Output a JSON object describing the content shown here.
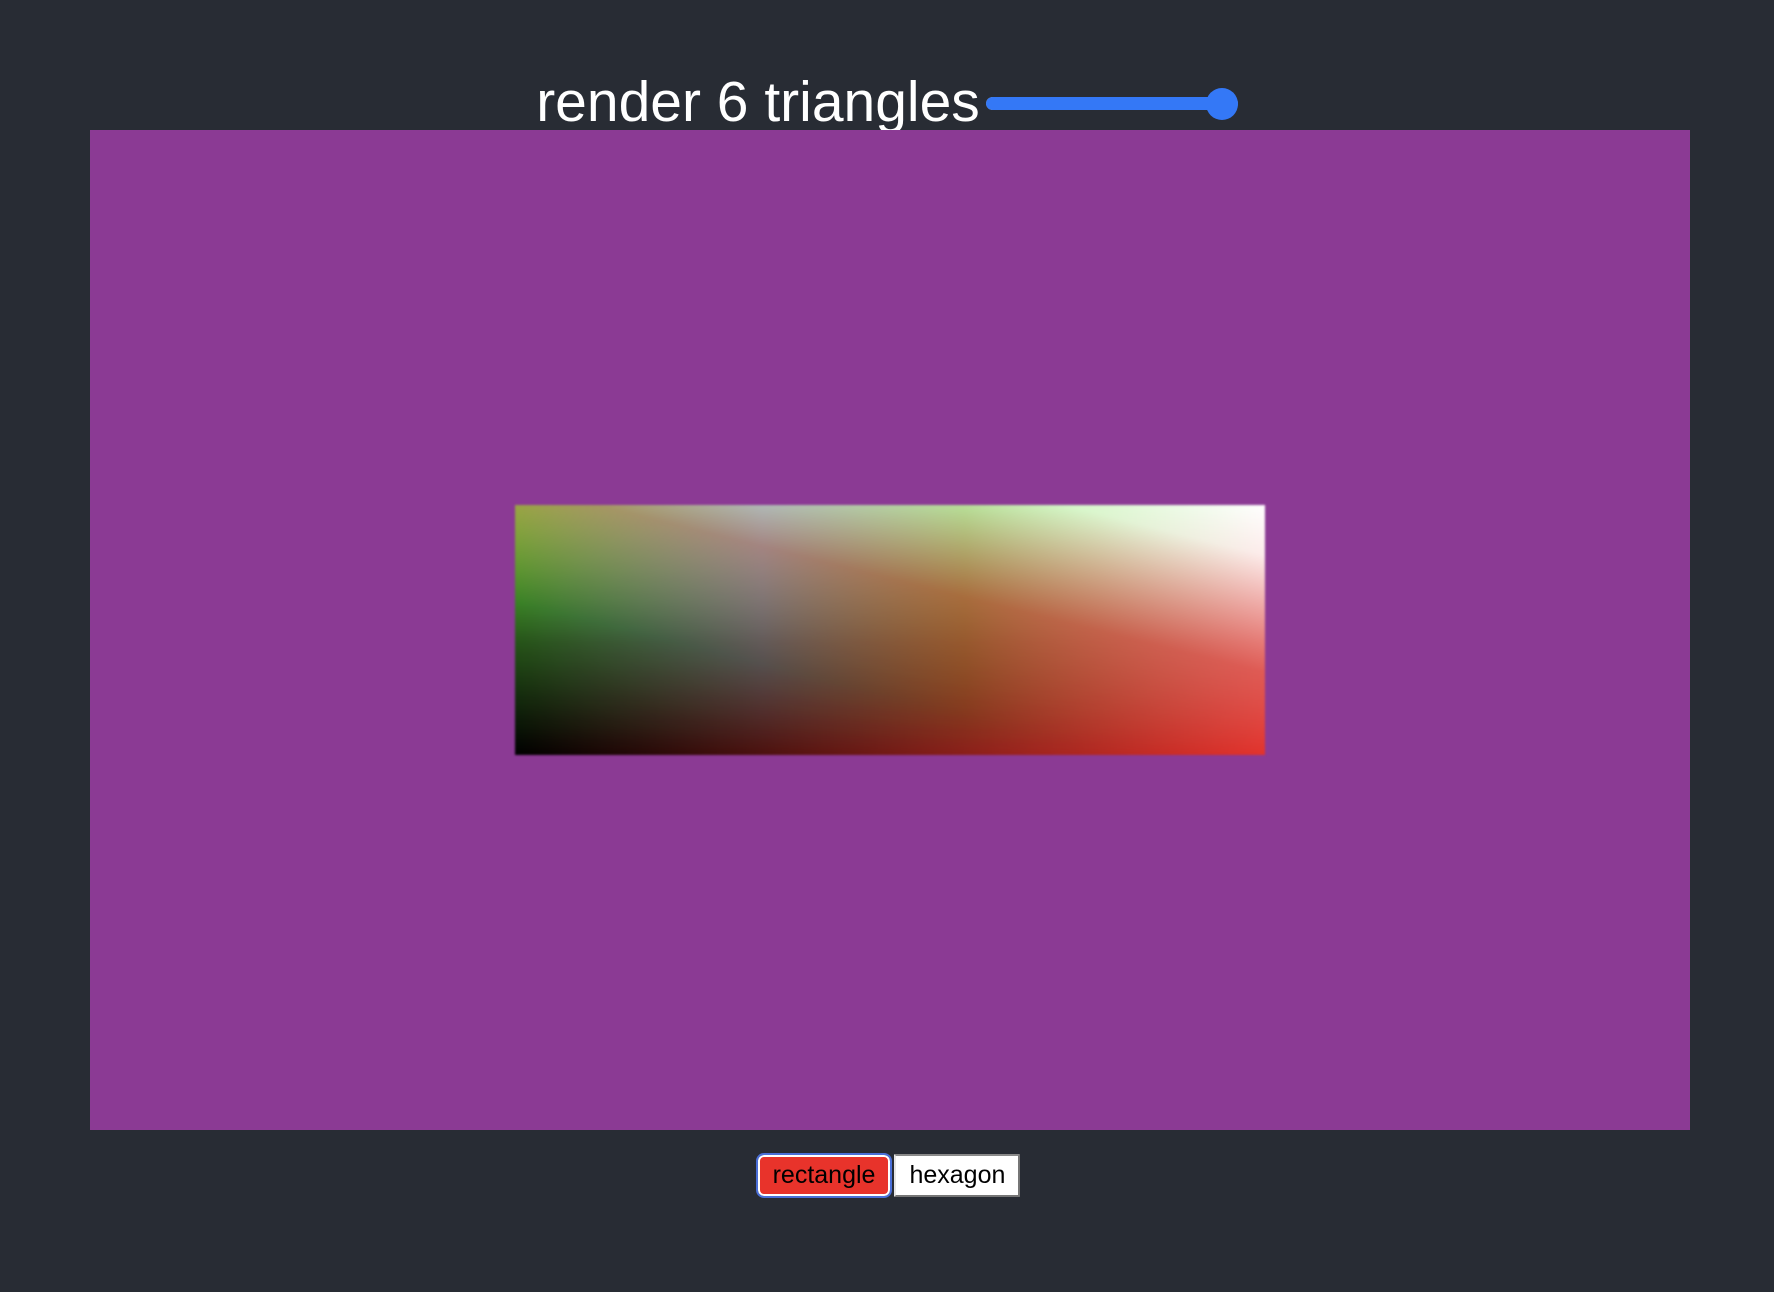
{
  "header": {
    "title": "render 6 triangles",
    "slider": {
      "value_fraction": 1.0,
      "track_color": "#9aa3b2",
      "fill_color": "#3478f6"
    }
  },
  "canvas": {
    "background_color": "#8b3a94",
    "shape": {
      "type": "rectangle",
      "triangle_count": 6,
      "vertex_colors": {
        "top_left": "#6cf044",
        "top_right": "#ffffff",
        "bottom_left": "#000000",
        "bottom_right": "#e8332b",
        "top_mid_a": "#6ef0f0",
        "top_mid_b": "#6cf044"
      }
    }
  },
  "controls": {
    "rectangle_label": "rectangle",
    "hexagon_label": "hexagon",
    "selected": "rectangle",
    "selected_color": "#e8332b"
  }
}
